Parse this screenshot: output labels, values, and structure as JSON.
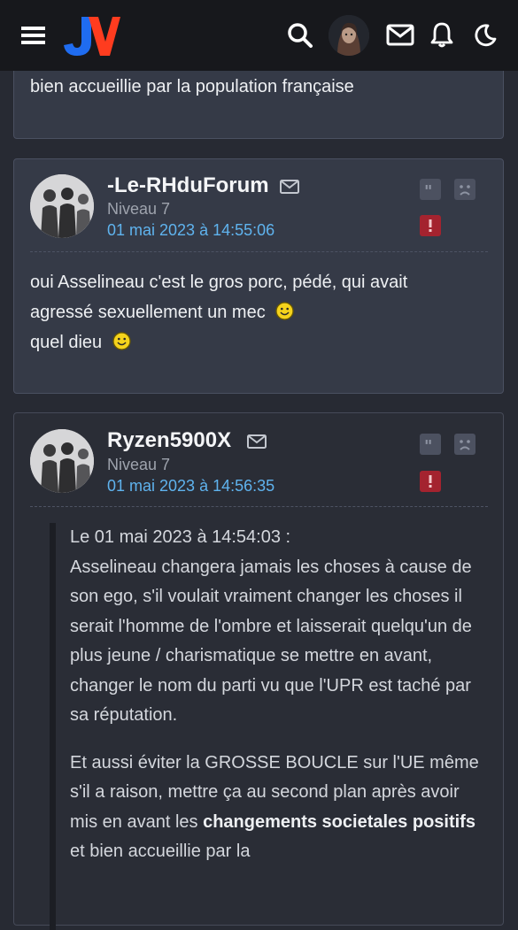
{
  "header": {
    "logo_text": "JV",
    "icons": [
      "menu-icon",
      "search-icon",
      "avatar",
      "mail-icon",
      "bell-icon",
      "moon-icon"
    ]
  },
  "fragment": {
    "text": "bien accueillie par la population française"
  },
  "posts": [
    {
      "username": "-Le-RHduForum",
      "level": "Niveau 7",
      "date": "01 mai 2023 à 14:55:06",
      "line1": "oui Asselineau c'est le gros porc, pédé, qui avait",
      "line2": "agressé sexuellement un mec",
      "line3": "quel dieu"
    },
    {
      "username": "Ryzen5900X",
      "level": "Niveau 7",
      "date": "01 mai 2023 à 14:56:35",
      "quote": {
        "header": "Le 01 mai 2023 à 14:54:03 :",
        "para1": "Asselineau changera jamais les choses à cause de son ego, s'il voulait vraiment changer les choses il serait l'homme de l'ombre et laisserait quelqu'un de plus jeune / charismatique se mettre en avant, changer le nom du parti vu que l'UPR est taché par sa réputation.",
        "para2_start": "Et aussi éviter la GROSSE BOUCLE sur l'UE même s'il a raison, mettre ça au second plan après avoir mis en avant les ",
        "para2_bold": "changements societales positifs",
        "para2_end": " et bien accueillie par la"
      }
    }
  ],
  "colors": {
    "topbar": "#17181c",
    "card": "#353a47",
    "date_link": "#5fb3ee",
    "report": "#a4232f",
    "logo_blue": "#1f6cf0",
    "logo_orange": "#ff3c1f"
  }
}
